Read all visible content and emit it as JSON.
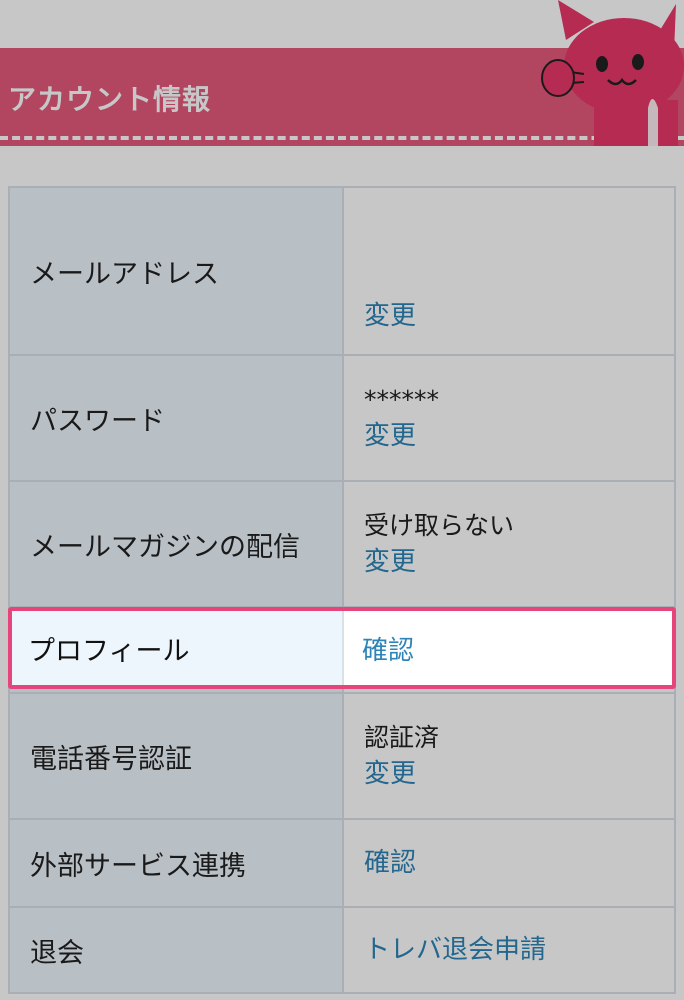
{
  "header": {
    "title": "アカウント情報"
  },
  "rows": [
    {
      "label": "メールアドレス",
      "value": "",
      "link": "変更"
    },
    {
      "label": "パスワード",
      "value": "******",
      "link": "変更"
    },
    {
      "label": "メールマガジンの配信",
      "value": "受け取らない",
      "link": "変更"
    },
    {
      "label": "プロフィール",
      "value": "",
      "link": "確認"
    },
    {
      "label": "電話番号認証",
      "value": "認証済",
      "link": "変更"
    },
    {
      "label": "外部サービス連携",
      "value": "",
      "link": "確認"
    },
    {
      "label": "退会",
      "value": "",
      "link": "トレバ退会申請"
    }
  ],
  "colors": {
    "accent": "#e55a7d",
    "highlight": "#e5457a",
    "link": "#2e84b7"
  },
  "icons": {
    "mascot": "pink-cat-mascot-icon"
  }
}
